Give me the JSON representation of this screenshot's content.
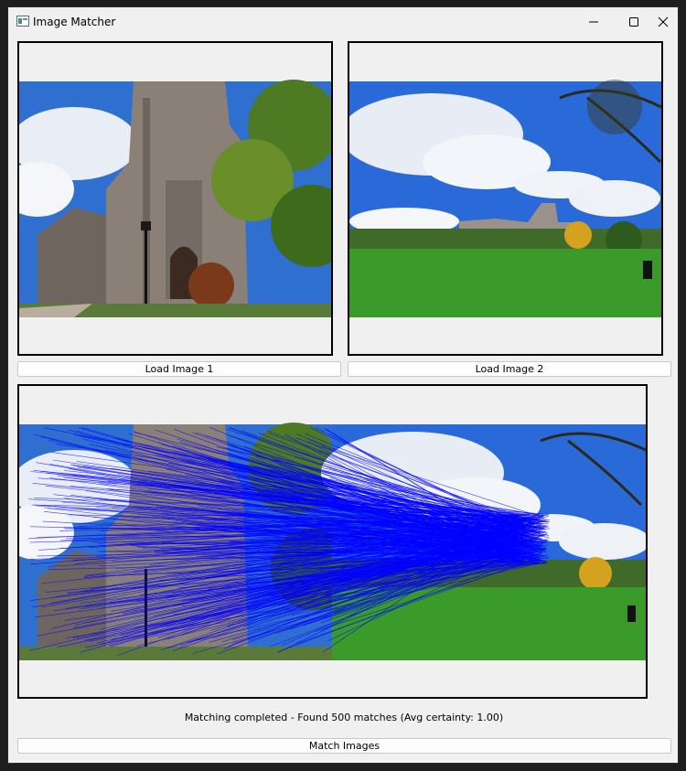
{
  "window": {
    "title": "Image Matcher"
  },
  "controls": {
    "minimize": "minimize-icon",
    "maximize": "maximize-icon",
    "close": "close-icon"
  },
  "buttons": {
    "load_image_1": "Load Image 1",
    "load_image_2": "Load Image 2",
    "match_images": "Match Images"
  },
  "status": {
    "text": "Matching completed - Found 500 matches (Avg certainty: 1.00)"
  },
  "colors": {
    "match_lines": "#0000ff",
    "sky": "#2f6fd0",
    "grass": "#3a8a2a",
    "stone": "#7a7068"
  },
  "matches": {
    "count": 500
  }
}
